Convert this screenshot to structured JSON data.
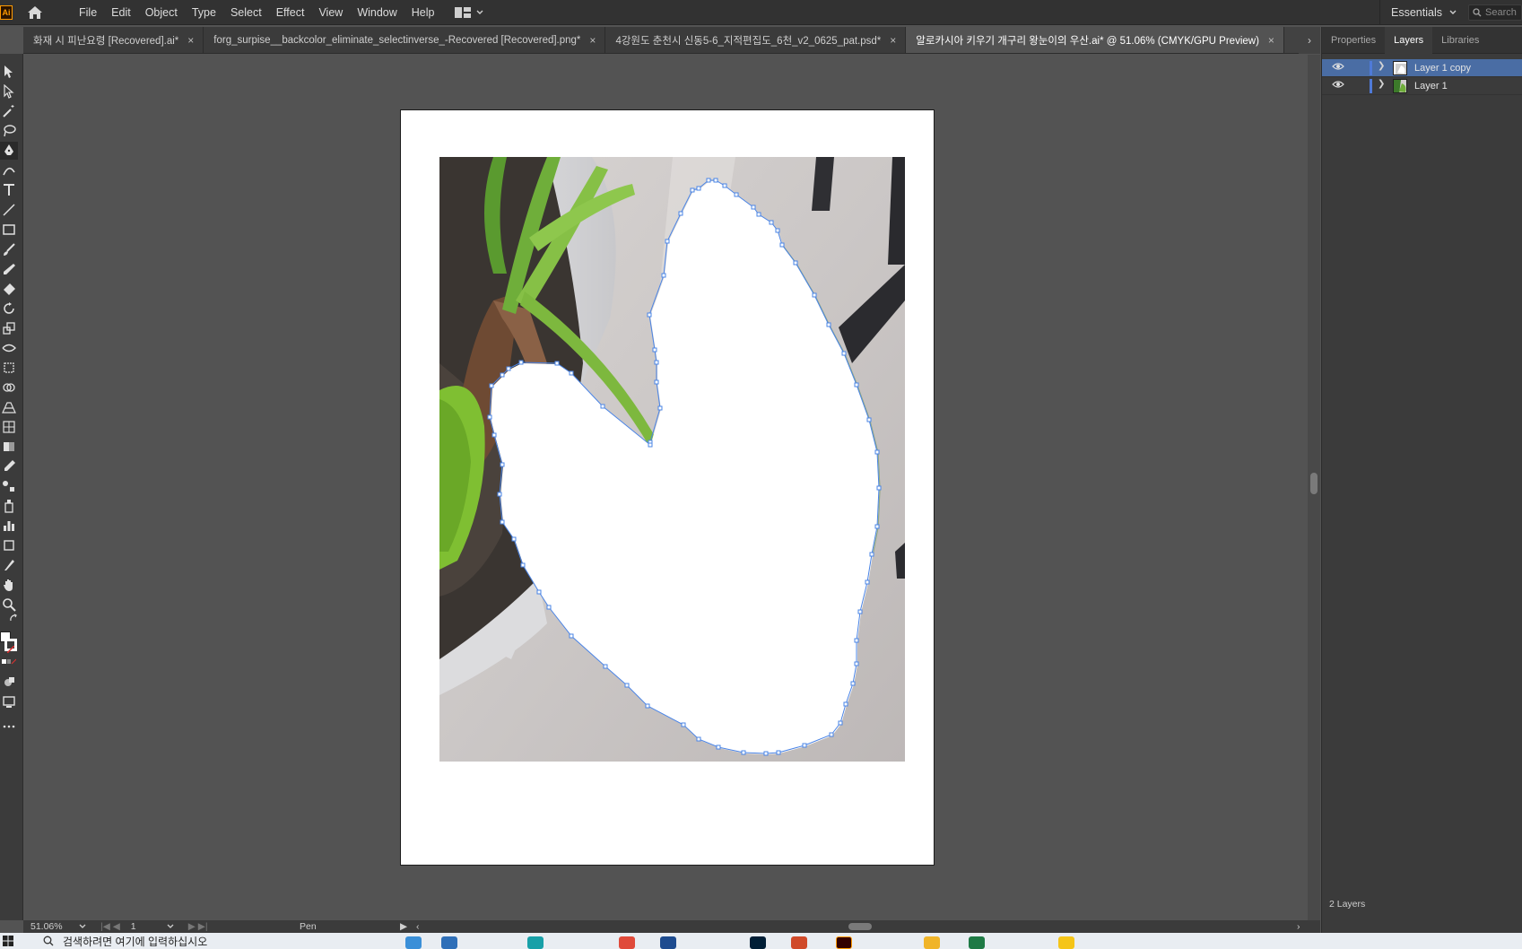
{
  "app": {
    "logo": "Ai",
    "menu": [
      "File",
      "Edit",
      "Object",
      "Type",
      "Select",
      "Effect",
      "View",
      "Window",
      "Help"
    ],
    "workspace": "Essentials",
    "search_placeholder": "Search"
  },
  "tabs": [
    {
      "label": "화재 시 피난요령 [Recovered].ai*",
      "active": false
    },
    {
      "label": "forg_surpise__backcolor_eliminate_selectinverse_-Recovered [Recovered].png*",
      "active": false
    },
    {
      "label": "4강원도 춘천시 신동5-6_지적편집도_6천_v2_0625_pat.psd*",
      "active": false
    },
    {
      "label": "알로카시아 키우기 개구리 왕눈이의 우산.ai* @ 51.06% (CMYK/GPU Preview)",
      "active": true
    }
  ],
  "tab_close": "×",
  "tab_overflow": "›",
  "panel": {
    "tabs": [
      "Properties",
      "Layers",
      "Libraries"
    ],
    "active_tab": "Layers",
    "collapse": "»",
    "layers": [
      {
        "name": "Layer 1 copy",
        "selected": true
      },
      {
        "name": "Layer 1",
        "selected": false
      }
    ],
    "layer_count": "2 Layers"
  },
  "status": {
    "zoom": "51.06%",
    "page": "1",
    "current_tool": "Pen"
  },
  "taskbar": {
    "search_text": "검색하려면 여기에 입력하십시오"
  },
  "colors": {
    "accent_selection": "#4a6da4",
    "path_color": "#4a84e6",
    "canvas_bg": "#535353"
  }
}
